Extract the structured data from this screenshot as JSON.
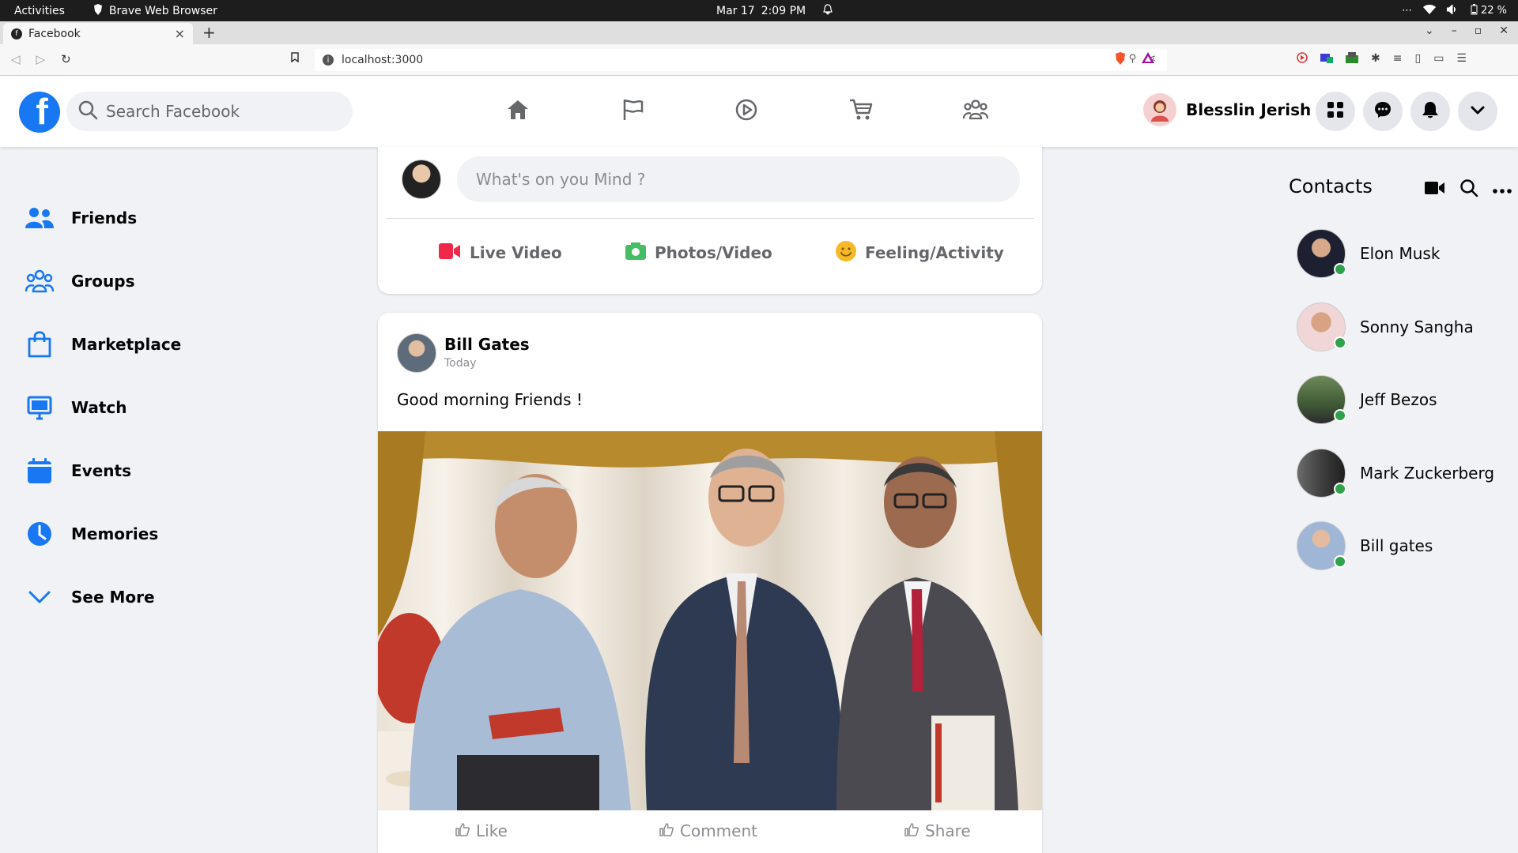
{
  "os": {
    "activities": "Activities",
    "app_name": "Brave Web Browser",
    "date": "Mar 17",
    "time": "2:09 PM",
    "battery": "22 %"
  },
  "browser": {
    "tab_title": "Facebook",
    "url": "localhost:3000"
  },
  "header": {
    "search_placeholder": "Search Facebook",
    "user_name": "Blesslin Jerish",
    "nav_icons": [
      "home-icon",
      "flag-icon",
      "watch-icon",
      "marketplace-icon",
      "groups-icon"
    ]
  },
  "sidebar": {
    "items": [
      {
        "label": "Friends",
        "icon": "friends-icon"
      },
      {
        "label": "Groups",
        "icon": "groups-icon"
      },
      {
        "label": "Marketplace",
        "icon": "marketplace-icon"
      },
      {
        "label": "Watch",
        "icon": "watch-icon"
      },
      {
        "label": "Events",
        "icon": "events-icon"
      },
      {
        "label": "Memories",
        "icon": "memories-icon"
      },
      {
        "label": "See More",
        "icon": "chevron-down-icon"
      }
    ]
  },
  "composer": {
    "placeholder": "What's on you Mind ?",
    "actions": [
      {
        "label": "Live Video",
        "icon": "live-video-icon",
        "color": "#f02849"
      },
      {
        "label": "Photos/Video",
        "icon": "photo-icon",
        "color": "#45bd62"
      },
      {
        "label": "Feeling/Activity",
        "icon": "feeling-icon",
        "color": "#f7b928"
      }
    ]
  },
  "post": {
    "author": "Bill Gates",
    "time": "Today",
    "text": "Good morning Friends !",
    "actions": [
      "Like",
      "Comment",
      "Share"
    ]
  },
  "contacts": {
    "title": "Contacts",
    "items": [
      {
        "name": "Elon Musk",
        "online": true
      },
      {
        "name": "Sonny Sangha",
        "online": true
      },
      {
        "name": "Jeff Bezos",
        "online": true
      },
      {
        "name": "Mark Zuckerberg",
        "online": true
      },
      {
        "name": "Bill gates",
        "online": true
      }
    ]
  },
  "colors": {
    "brand": "#1877f2",
    "online": "#31a24c"
  }
}
